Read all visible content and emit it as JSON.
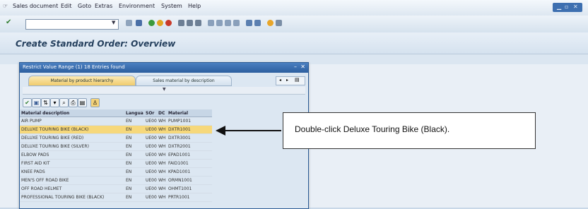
{
  "menu": {
    "items": [
      "Sales document",
      "Edit",
      "Goto",
      "Extras",
      "Environment",
      "System",
      "Help"
    ]
  },
  "page": {
    "title": "Create Standard Order: Overview"
  },
  "dialog": {
    "title": "Restrict Value Range (1)   18 Entries found",
    "tabs": [
      "Material by product hierarchy",
      "Sales material by description"
    ],
    "columns": [
      "Material description",
      "Langua",
      "SOr",
      "DC",
      "Material"
    ],
    "rows": [
      {
        "desc": "AIR PUMP",
        "lang": "EN",
        "sorg": "UE00",
        "dc": "WH",
        "material": "PUMP1001"
      },
      {
        "desc": "DELUXE TOURING BIKE (BLACK)",
        "lang": "EN",
        "sorg": "UE00",
        "dc": "WH",
        "material": "DXTR1001"
      },
      {
        "desc": "DELUXE TOURING BIKE (RED)",
        "lang": "EN",
        "sorg": "UE00",
        "dc": "WH",
        "material": "DXTR3001"
      },
      {
        "desc": "DELUXE TOURING BIKE (SILVER)",
        "lang": "EN",
        "sorg": "UE00",
        "dc": "WH",
        "material": "DXTR2001"
      },
      {
        "desc": "ELBOW PADS",
        "lang": "EN",
        "sorg": "UE00",
        "dc": "WH",
        "material": "EPAD1001"
      },
      {
        "desc": "FIRST AID KIT",
        "lang": "EN",
        "sorg": "UE00",
        "dc": "WH",
        "material": "FAID1001"
      },
      {
        "desc": "KNEE PADS",
        "lang": "EN",
        "sorg": "UE00",
        "dc": "WH",
        "material": "KPAD1001"
      },
      {
        "desc": "MEN'S OFF ROAD BIKE",
        "lang": "EN",
        "sorg": "UE00",
        "dc": "WH",
        "material": "ORMN1001"
      },
      {
        "desc": "OFF ROAD HELMET",
        "lang": "EN",
        "sorg": "UE00",
        "dc": "WH",
        "material": "OHMT1001"
      },
      {
        "desc": "PROFESSIONAL TOURING BIKE (BLACK)",
        "lang": "EN",
        "sorg": "UE00",
        "dc": "WH",
        "material": "PRTR1001"
      }
    ],
    "selected_row_index": 1
  },
  "callout": {
    "text": "Double-click Deluxe Touring Bike (Black)."
  },
  "colors": {
    "accent": "#2d5f9f",
    "selected": "#f6d87b",
    "title_text": "#25405e"
  },
  "icons": [
    "enter-icon",
    "save-icon",
    "back-icon",
    "exit-icon",
    "cancel-icon",
    "print-icon",
    "find-icon",
    "help-icon"
  ]
}
